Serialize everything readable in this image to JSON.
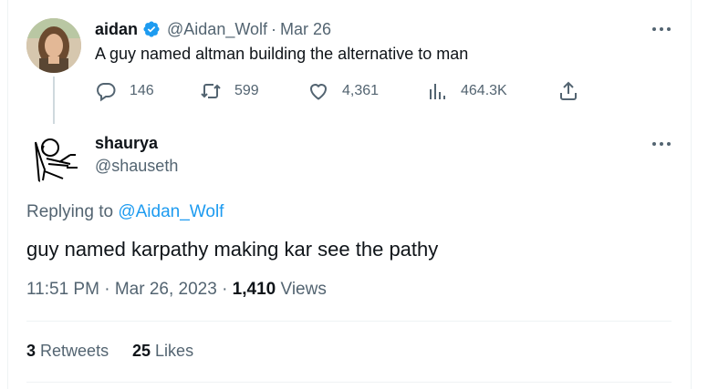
{
  "parent_tweet": {
    "name": "aidan",
    "handle": "@Aidan_Wolf",
    "separator": "·",
    "date": "Mar 26",
    "text": "A guy named altman building the alternative to man",
    "replies": "146",
    "retweets": "599",
    "likes": "4,361",
    "views": "464.3K"
  },
  "main_tweet": {
    "name": "shaurya",
    "handle": "@shauseth",
    "replying_prefix": "Replying to",
    "replying_handle": "@Aidan_Wolf",
    "text": "guy named karpathy making kar see the pathy",
    "time": "11:51 PM",
    "separator": "·",
    "date": "Mar 26, 2023",
    "views_count": "1,410",
    "views_label": "Views",
    "retweets_count": "3",
    "retweets_label": "Retweets",
    "likes_count": "25",
    "likes_label": "Likes"
  },
  "colors": {
    "accent": "#1d9bf0",
    "secondary_text": "#536471",
    "primary_text": "#0f1419"
  },
  "icons": [
    "verified-badge-icon",
    "reply-icon",
    "retweet-icon",
    "like-icon",
    "views-icon",
    "share-icon",
    "more-icon"
  ]
}
